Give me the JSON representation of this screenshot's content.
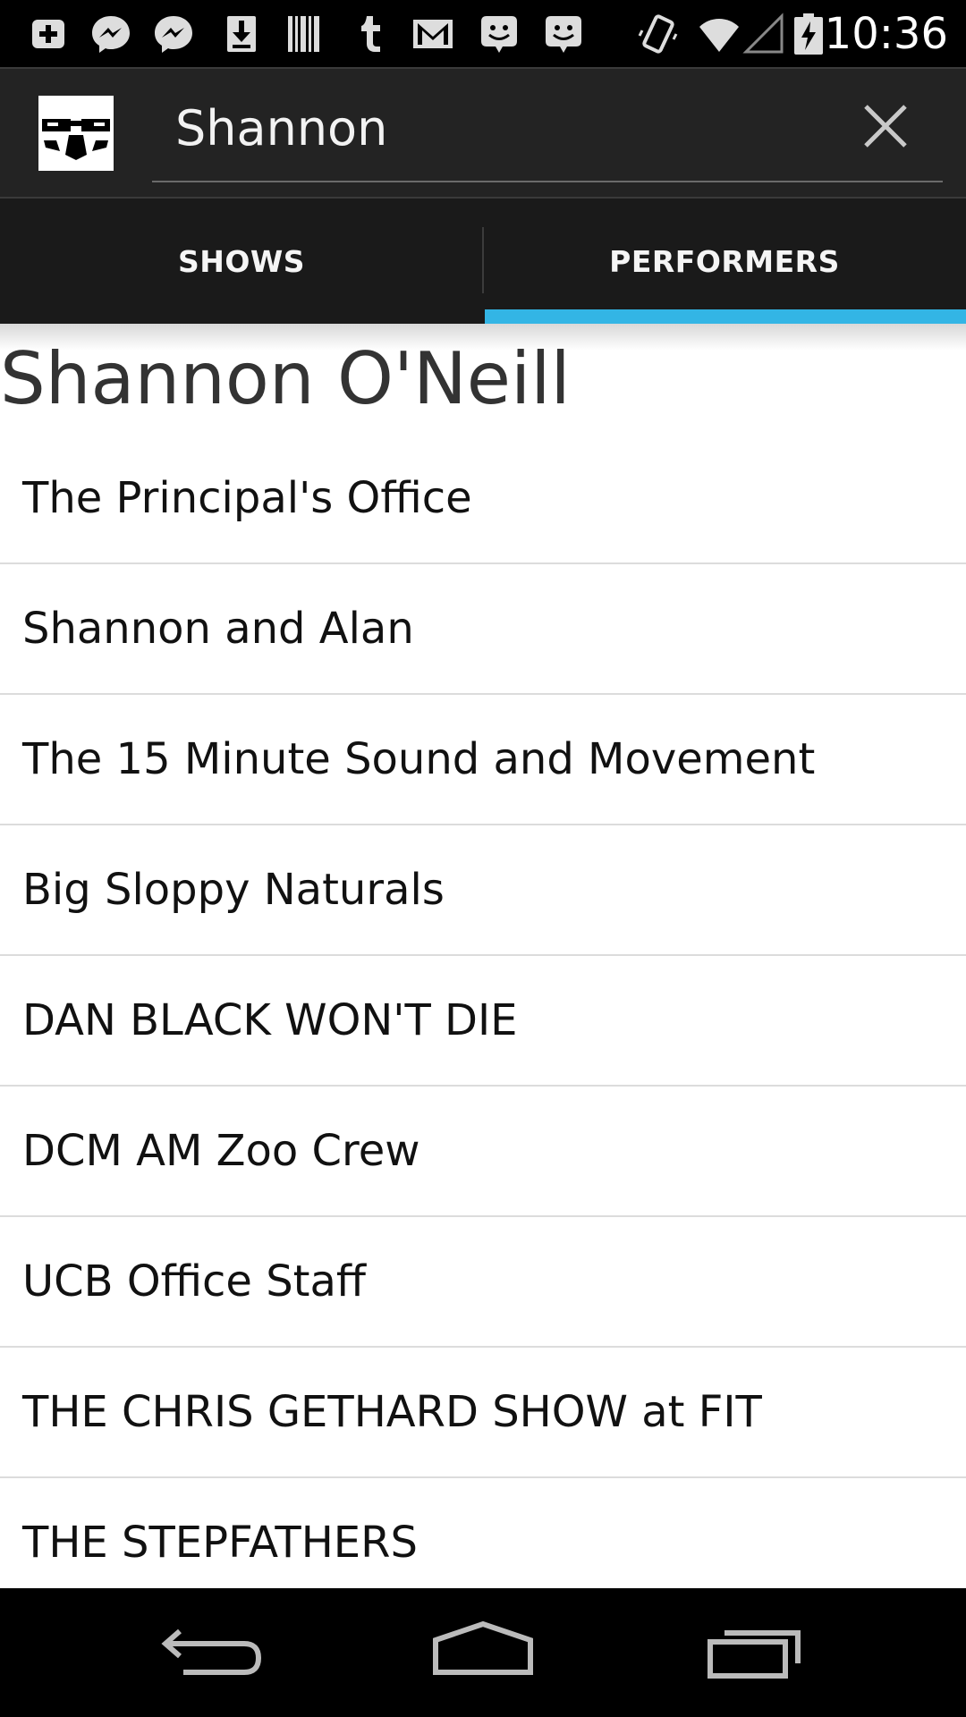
{
  "status_bar": {
    "time": "10:36",
    "notification_icons": [
      "plus-box-icon",
      "messenger-icon",
      "messenger-icon",
      "download-icon",
      "barcode-icon",
      "tumblr-icon",
      "gmail-icon",
      "chat-bubble-icon",
      "chat-bubble-icon"
    ],
    "system_icons": [
      "vibrate-icon",
      "wifi-icon",
      "signal-icon",
      "battery-charging-icon"
    ]
  },
  "action_bar": {
    "logo_icon": "app-logo-face-icon",
    "search": {
      "value": "Shannon",
      "placeholder": ""
    },
    "clear_icon": "close-icon"
  },
  "tabs": [
    {
      "label": "SHOWS",
      "selected": false
    },
    {
      "label": "PERFORMERS",
      "selected": true
    }
  ],
  "colors": {
    "accent": "#33b5e5",
    "action_bar": "#232323",
    "tab_bar": "#1a1a1a"
  },
  "performer": {
    "name": "Shannon O'Neill",
    "shows": [
      "The Principal's Office",
      "Shannon and Alan",
      "The 15 Minute Sound and Movement",
      "Big Sloppy Naturals",
      "DAN BLACK WON'T DIE",
      "DCM AM Zoo Crew",
      "UCB Office Staff",
      "THE CHRIS GETHARD SHOW at FIT",
      "THE STEPFATHERS"
    ]
  },
  "nav_bar": {
    "buttons": [
      "back-icon",
      "home-icon",
      "recents-icon"
    ]
  }
}
